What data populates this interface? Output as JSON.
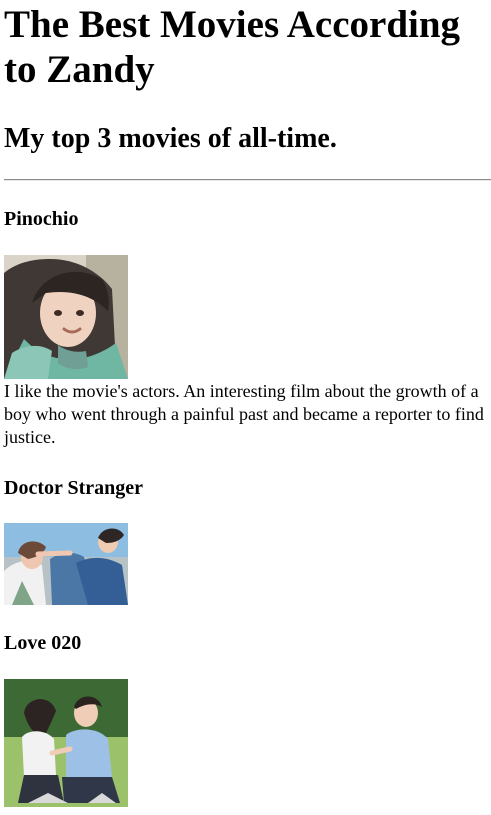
{
  "page": {
    "title": "The Best Movies According to Zandy",
    "subtitle": "My top 3 movies of all-time."
  },
  "movies": [
    {
      "name": "Pinochio",
      "image_name": "pinochio-poster",
      "review": "I like the movie's actors. An interesting film about the growth of a boy who went through a painful past and became a reporter to find justice."
    },
    {
      "name": "Doctor Stranger",
      "image_name": "doctor-stranger-poster"
    },
    {
      "name": "Love 020",
      "image_name": "love-020-poster"
    }
  ],
  "colors": {
    "text": "#000000",
    "background": "#ffffff",
    "divider": "#8a8a8a"
  }
}
